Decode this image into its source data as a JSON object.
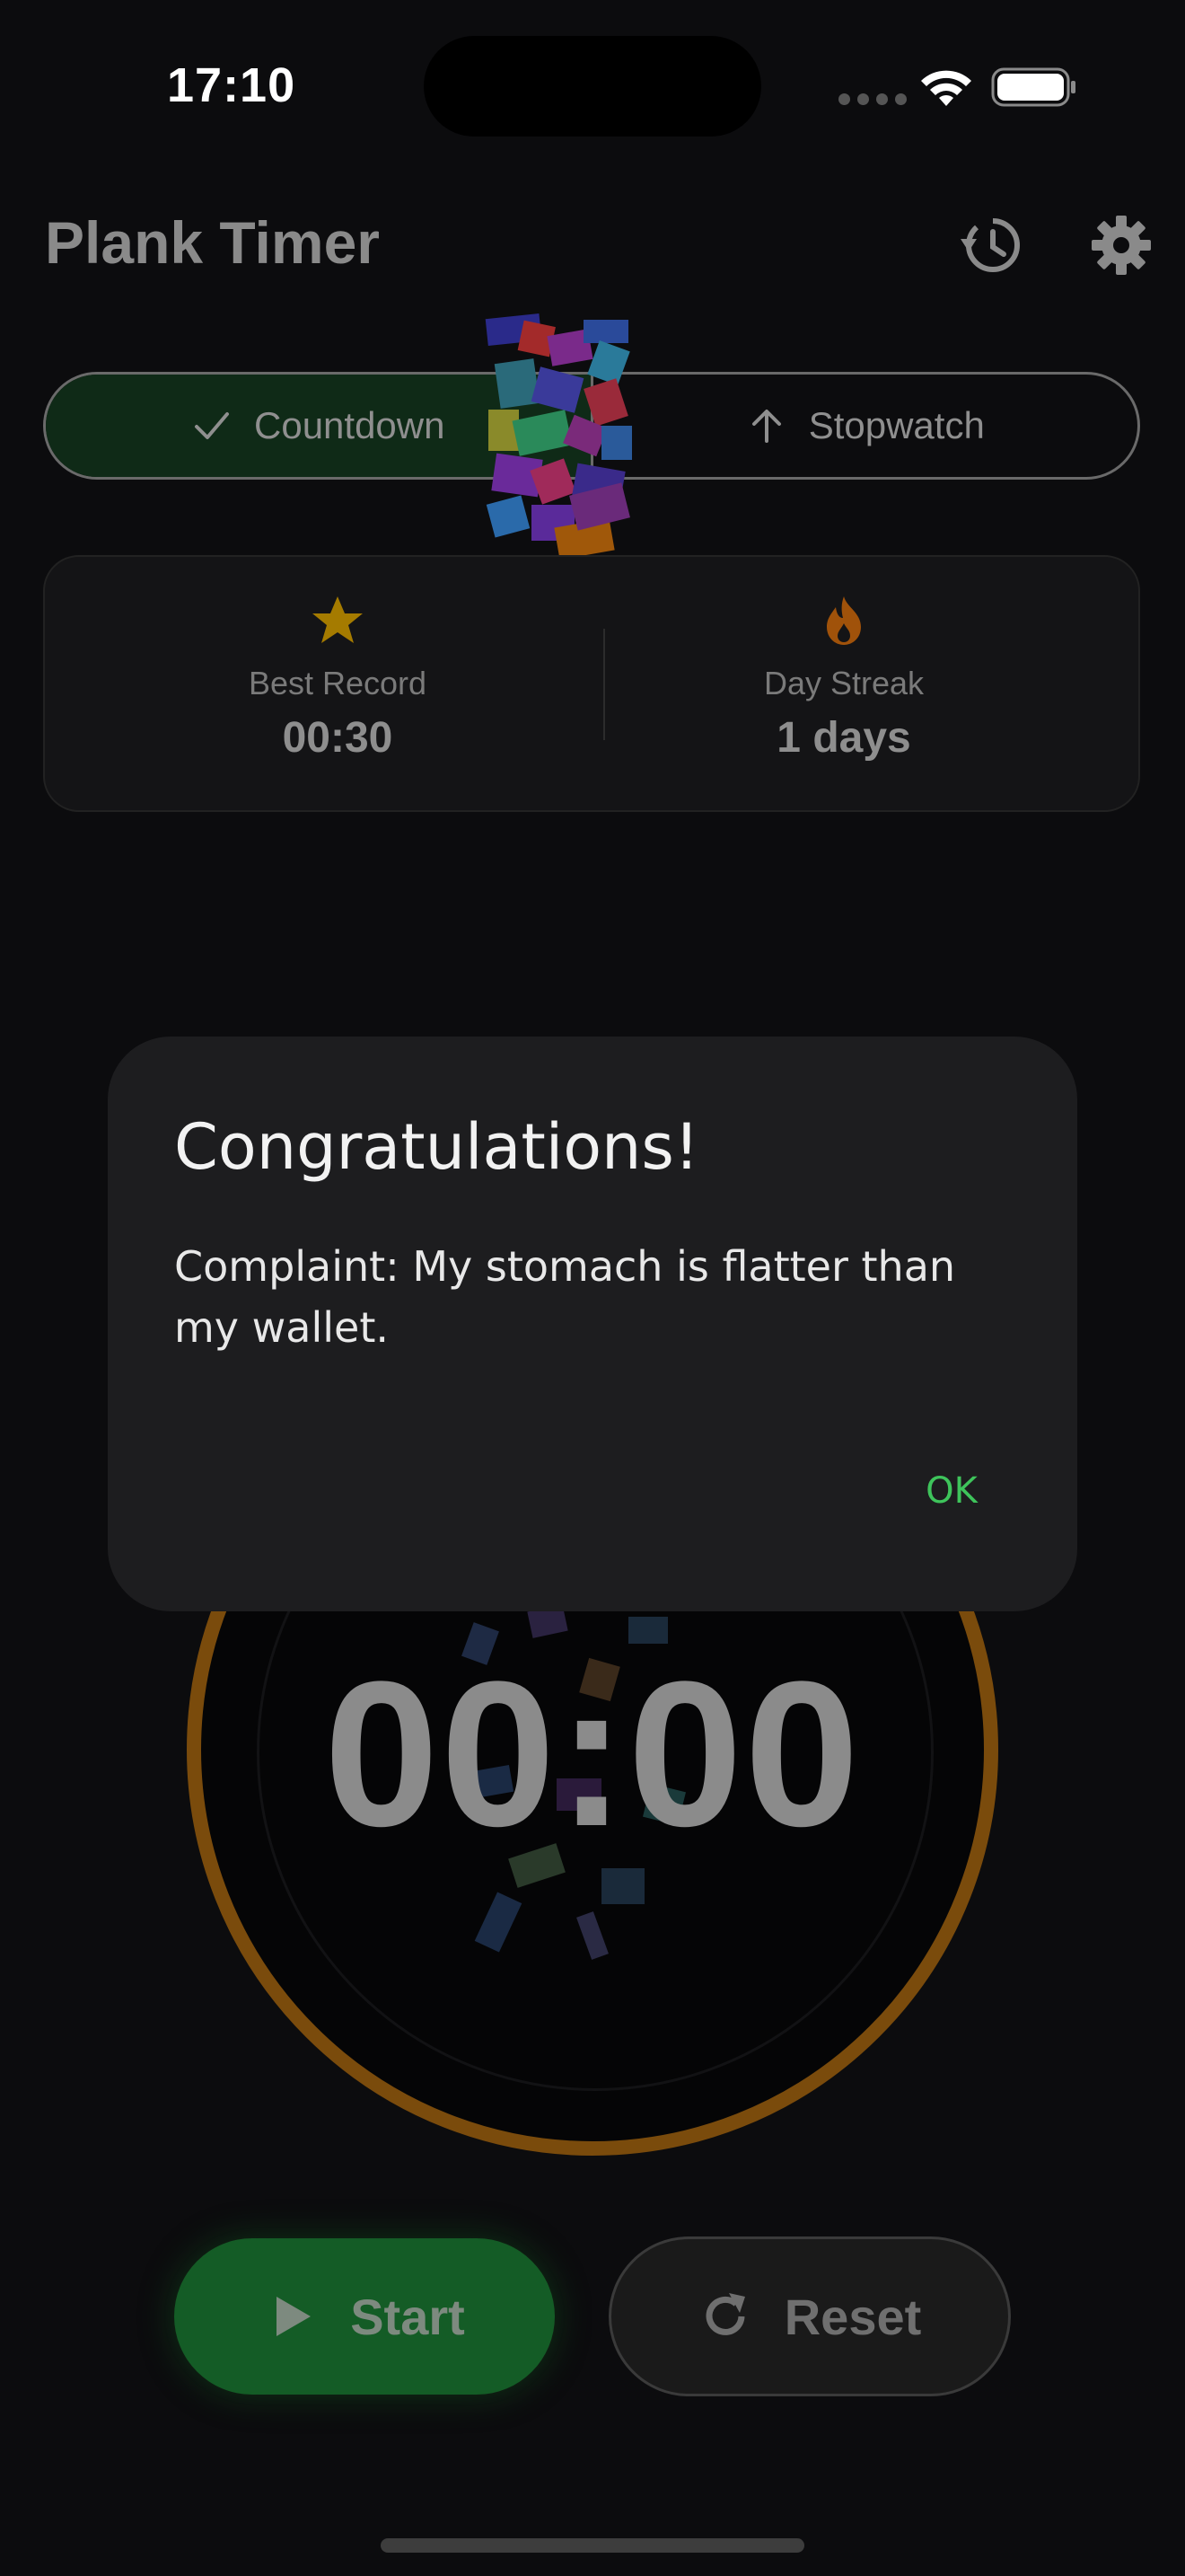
{
  "status_bar": {
    "time": "17:10"
  },
  "header": {
    "title": "Plank Timer",
    "history_icon": "history-icon",
    "settings_icon": "gear-icon"
  },
  "mode_selector": {
    "options": [
      {
        "label": "Countdown",
        "icon": "check-icon",
        "selected": true
      },
      {
        "label": "Stopwatch",
        "icon": "arrow-up-icon",
        "selected": false
      }
    ]
  },
  "stats": {
    "best_record": {
      "label": "Best Record",
      "value": "00:30",
      "icon": "star-icon"
    },
    "day_streak": {
      "label": "Day Streak",
      "value": "1 days",
      "icon": "flame-icon"
    }
  },
  "timer": {
    "display": "00:00"
  },
  "controls": {
    "start_label": "Start",
    "reset_label": "Reset"
  },
  "dialog": {
    "title": "Congratulations!",
    "message": "Complaint: My stomach is flatter than my wallet.",
    "ok_label": "OK"
  },
  "colors": {
    "accent_green": "#3ec45b",
    "ring_orange": "#7a4b0c",
    "star_gold": "#a57b00",
    "flame_orange": "#a0520a",
    "dialog_bg": "#1d1d1f"
  }
}
